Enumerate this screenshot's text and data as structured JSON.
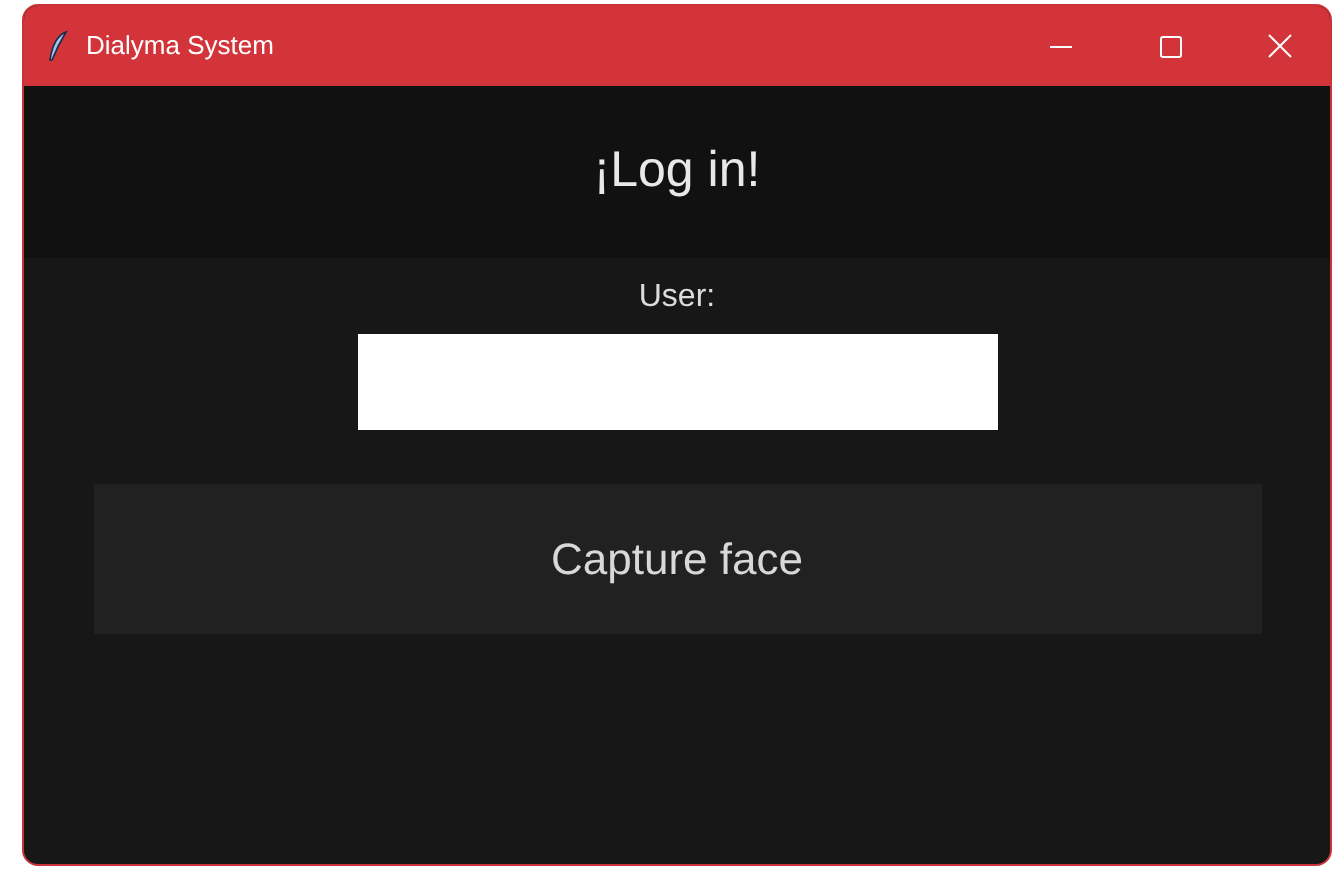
{
  "window": {
    "title": "Dialyma System"
  },
  "heading": "¡Log in!",
  "user_field": {
    "label": "User:"
  },
  "buttons": [
    "Capture face"
  ]
}
